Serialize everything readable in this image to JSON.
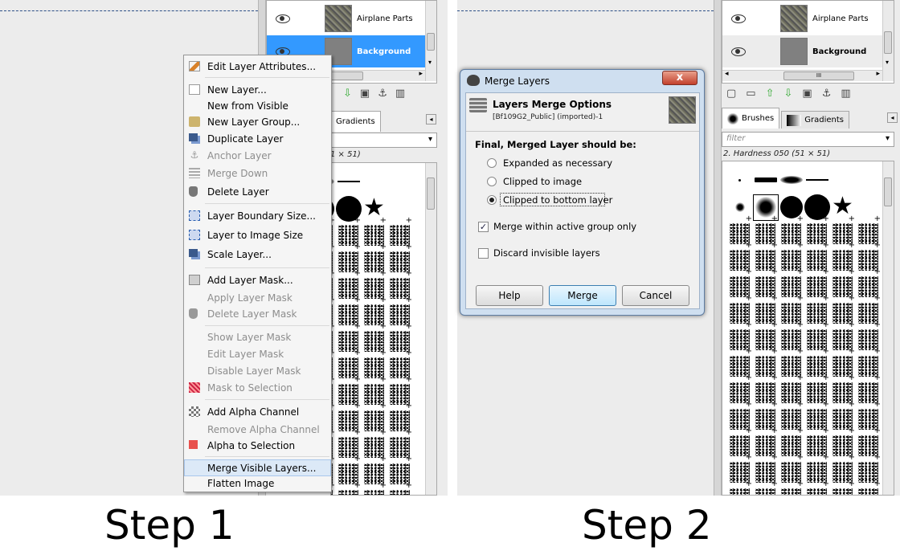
{
  "left_panel": {
    "layers": [
      {
        "name": "Airplane Parts",
        "selected": false
      },
      {
        "name": "Background",
        "selected": true
      }
    ],
    "tabs": {
      "brushes": "",
      "gradients": "Gradients"
    },
    "brush_info": "1 × 51)",
    "context_menu": [
      {
        "label": "Edit Layer Attributes...",
        "icon": "pencil-icon",
        "enabled": true
      },
      {
        "label": "New Layer...",
        "icon": "page-icon",
        "enabled": true
      },
      {
        "label": "New from Visible",
        "icon": "",
        "enabled": true
      },
      {
        "label": "New Layer Group...",
        "icon": "folder-icon",
        "enabled": true
      },
      {
        "label": "Duplicate Layer",
        "icon": "duplicate-icon",
        "enabled": true
      },
      {
        "label": "Anchor Layer",
        "icon": "anchor-icon",
        "enabled": false
      },
      {
        "label": "Merge Down",
        "icon": "merge-down-icon",
        "enabled": false
      },
      {
        "label": "Delete Layer",
        "icon": "trash-icon",
        "enabled": true
      },
      {
        "label": "Layer Boundary Size...",
        "icon": "boundary-icon",
        "enabled": true
      },
      {
        "label": "Layer to Image Size",
        "icon": "layer-to-image-icon",
        "enabled": true
      },
      {
        "label": "Scale Layer...",
        "icon": "scale-icon",
        "enabled": true
      },
      {
        "label": "Add Layer Mask...",
        "icon": "mask-icon",
        "enabled": true
      },
      {
        "label": "Apply Layer Mask",
        "icon": "",
        "enabled": false
      },
      {
        "label": "Delete Layer Mask",
        "icon": "trash-icon",
        "enabled": false
      },
      {
        "label": "Show Layer Mask",
        "icon": "",
        "enabled": false
      },
      {
        "label": "Edit Layer Mask",
        "icon": "",
        "enabled": false
      },
      {
        "label": "Disable Layer Mask",
        "icon": "",
        "enabled": false
      },
      {
        "label": "Mask to Selection",
        "icon": "mask-selection-icon",
        "enabled": false
      },
      {
        "label": "Add Alpha Channel",
        "icon": "alpha-icon",
        "enabled": true
      },
      {
        "label": "Remove Alpha Channel",
        "icon": "",
        "enabled": false
      },
      {
        "label": "Alpha to Selection",
        "icon": "alpha-selection-icon",
        "enabled": true
      },
      {
        "label": "Merge Visible Layers...",
        "icon": "",
        "enabled": true,
        "highlighted": true
      },
      {
        "label": "Flatten Image",
        "icon": "",
        "enabled": true
      }
    ]
  },
  "right_panel": {
    "layers": [
      {
        "name": "Airplane Parts",
        "selected": false
      },
      {
        "name": "Background",
        "selected": false
      }
    ],
    "scroll_label": "III",
    "tabs": {
      "brushes": "Brushes",
      "gradients": "Gradients"
    },
    "filter_placeholder": "filter",
    "brush_info": "2. Hardness 050 (51 × 51)"
  },
  "dialog": {
    "title": "Merge Layers",
    "close_label": "x",
    "header_title": "Layers Merge Options",
    "header_subtitle": "[Bf109G2_Public] (imported)-1",
    "section_label": "Final, Merged Layer should be:",
    "options": [
      {
        "label": "Expanded as necessary",
        "selected": false
      },
      {
        "label": "Clipped to image",
        "selected": false
      },
      {
        "label": "Clipped to bottom layer",
        "selected": true
      }
    ],
    "checks": [
      {
        "label": "Merge within active group only",
        "checked": true
      },
      {
        "label": "Discard invisible layers",
        "checked": false
      }
    ],
    "buttons": {
      "help": "Help",
      "merge": "Merge",
      "cancel": "Cancel"
    }
  },
  "captions": {
    "step1": "Step 1",
    "step2": "Step 2"
  }
}
